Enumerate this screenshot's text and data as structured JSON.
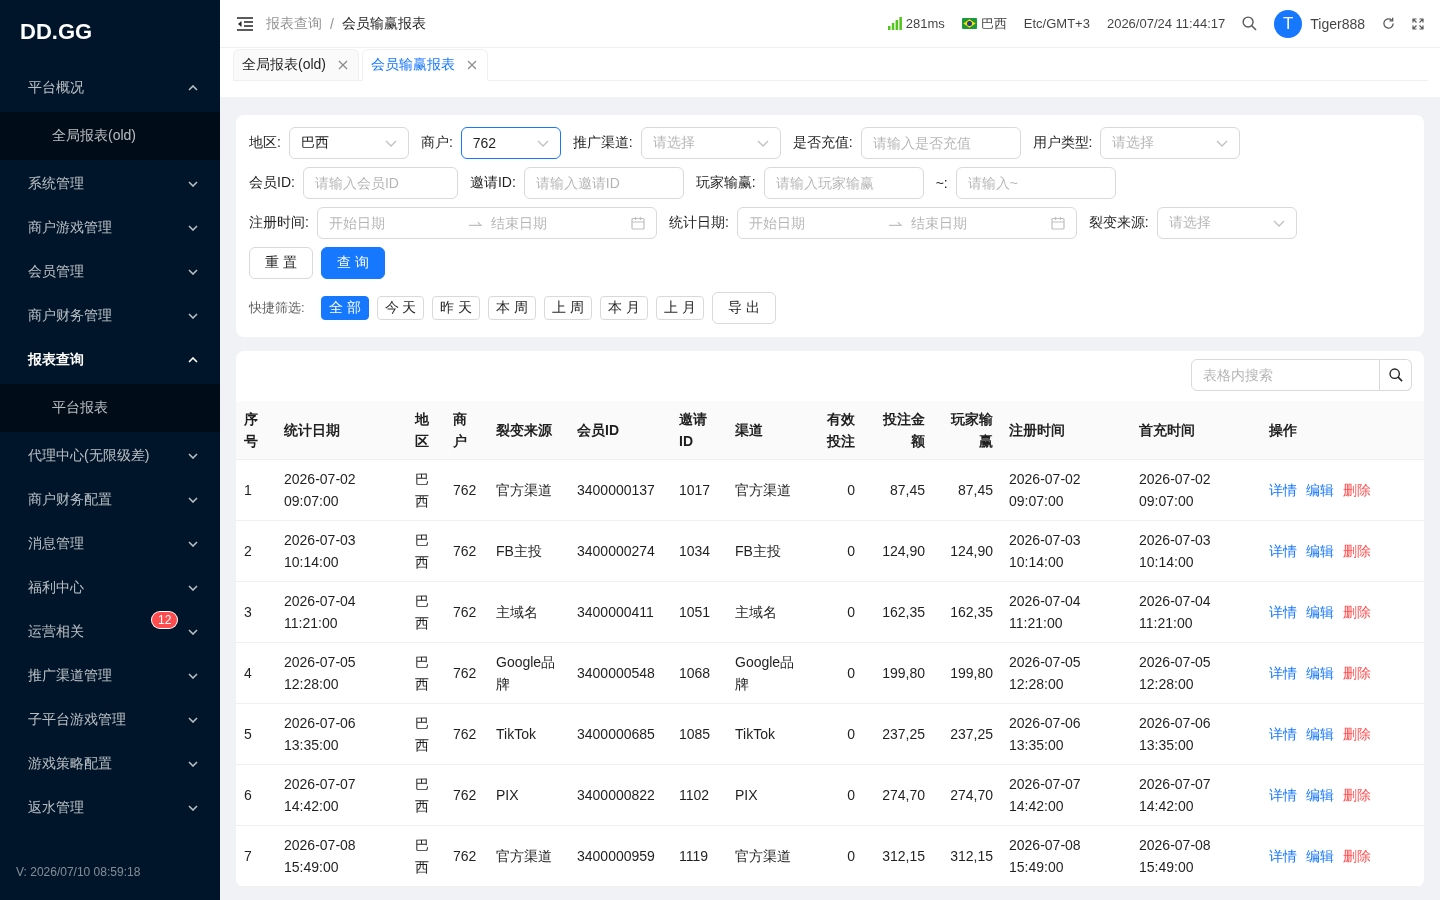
{
  "sidebar": {
    "logo": "DD.GG",
    "items": [
      {
        "label": "平台概况",
        "expanded": true,
        "selected": false,
        "children": [
          {
            "label": "全局报表(old)",
            "selected": false
          }
        ]
      },
      {
        "label": "系统管理",
        "expanded": false,
        "selected": false
      },
      {
        "label": "商户游戏管理",
        "expanded": false,
        "selected": false
      },
      {
        "label": "会员管理",
        "expanded": false,
        "selected": false
      },
      {
        "label": "商户财务管理",
        "expanded": false,
        "selected": false
      },
      {
        "label": "报表查询",
        "expanded": true,
        "selected": true,
        "children": [
          {
            "label": "平台报表",
            "selected": false
          }
        ]
      },
      {
        "label": "代理中心(无限级差)",
        "expanded": false,
        "selected": false
      },
      {
        "label": "商户财务配置",
        "expanded": false,
        "selected": false
      },
      {
        "label": "消息管理",
        "expanded": false,
        "selected": false
      },
      {
        "label": "福利中心",
        "expanded": false,
        "selected": false
      },
      {
        "label": "运营相关",
        "expanded": false,
        "selected": false,
        "badge": "12"
      },
      {
        "label": "推广渠道管理",
        "expanded": false,
        "selected": false
      },
      {
        "label": "子平台游戏管理",
        "expanded": false,
        "selected": false
      },
      {
        "label": "游戏策略配置",
        "expanded": false,
        "selected": false
      },
      {
        "label": "返水管理",
        "expanded": false,
        "selected": false
      }
    ],
    "version": "V: 2026/07/10 08:59:18"
  },
  "header": {
    "breadcrumb": [
      "报表查询",
      "会员输赢报表"
    ],
    "breadcrumb_separator": "/",
    "latency": "281ms",
    "region": "巴西",
    "timezone": "Etc/GMT+3",
    "datetime": "2026/07/24 11:44:17",
    "user": {
      "initial": "T",
      "name": "Tiger888"
    }
  },
  "tabs": [
    {
      "label": "全局报表(old)",
      "selected": false
    },
    {
      "label": "会员输赢报表",
      "selected": true
    }
  ],
  "filters": {
    "rows": [
      [
        {
          "kind": "select",
          "label": "地区:",
          "value": "巴西",
          "focused": false
        },
        {
          "kind": "select",
          "label": "商户:",
          "value": "762",
          "focused": true
        },
        {
          "kind": "select",
          "label": "推广渠道:",
          "placeholder": "请选择",
          "focused": false
        },
        {
          "kind": "input",
          "label": "是否充值:",
          "placeholder": "请输入是否充值",
          "focused": false
        },
        {
          "kind": "select",
          "label": "用户类型:",
          "placeholder": "请选择",
          "focused": false
        }
      ],
      [
        {
          "kind": "input",
          "label": "会员ID:",
          "placeholder": "请输入会员ID",
          "focused": false
        },
        {
          "kind": "input",
          "label": "邀请ID:",
          "placeholder": "请输入邀请ID",
          "focused": false
        },
        {
          "kind": "input",
          "label": "玩家输赢:",
          "placeholder": "请输入玩家输赢",
          "focused": false
        },
        {
          "kind": "input",
          "label": "~:",
          "placeholder": "请输入~",
          "focused": false
        }
      ],
      [
        {
          "kind": "daterange",
          "label": "注册时间:",
          "start_placeholder": "开始日期",
          "end_placeholder": "结束日期",
          "focused": false
        },
        {
          "kind": "daterange",
          "label": "统计日期:",
          "start_placeholder": "开始日期",
          "end_placeholder": "结束日期",
          "focused": false
        },
        {
          "kind": "select",
          "label": "裂变来源:",
          "placeholder": "请选择",
          "focused": false
        }
      ]
    ],
    "buttons": [
      {
        "label": "重 置",
        "kind": "default"
      },
      {
        "label": "查 询",
        "kind": "primary"
      }
    ],
    "quick_label": "快捷筛选:",
    "quick": [
      {
        "label": "全 部",
        "selected": true
      },
      {
        "label": "今 天",
        "selected": false
      },
      {
        "label": "昨 天",
        "selected": false
      },
      {
        "label": "本 周",
        "selected": false
      },
      {
        "label": "上 周",
        "selected": false
      },
      {
        "label": "本 月",
        "selected": false
      },
      {
        "label": "上 月",
        "selected": false
      }
    ],
    "export": "导 出"
  },
  "table": {
    "search_placeholder": "表格内搜索",
    "columns": [
      "序号",
      "统计日期",
      "地区",
      "商户",
      "裂变来源",
      "会员ID",
      "邀请ID",
      "渠道",
      "有效投注",
      "投注金额",
      "玩家输赢",
      "注册时间",
      "首充时间",
      "操作"
    ],
    "rows": [
      {
        "cells": [
          "1",
          "2026-07-02 09:07:00",
          "巴西",
          "762",
          "官方渠道",
          "3400000137",
          "1017",
          "官方渠道",
          "0",
          "87,45",
          "87,45",
          "2026-07-02 09:07:00",
          "2026-07-02 09:07:00"
        ],
        "actions": [
          {
            "label": "详情",
            "kind": "link"
          },
          {
            "label": "编辑",
            "kind": "link"
          },
          {
            "label": "删除",
            "kind": "danger"
          }
        ]
      },
      {
        "cells": [
          "2",
          "2026-07-03 10:14:00",
          "巴西",
          "762",
          "FB主投",
          "3400000274",
          "1034",
          "FB主投",
          "0",
          "124,90",
          "124,90",
          "2026-07-03 10:14:00",
          "2026-07-03 10:14:00"
        ],
        "actions": [
          {
            "label": "详情",
            "kind": "link"
          },
          {
            "label": "编辑",
            "kind": "link"
          },
          {
            "label": "删除",
            "kind": "danger"
          }
        ]
      },
      {
        "cells": [
          "3",
          "2026-07-04 11:21:00",
          "巴西",
          "762",
          "主域名",
          "3400000411",
          "1051",
          "主域名",
          "0",
          "162,35",
          "162,35",
          "2026-07-04 11:21:00",
          "2026-07-04 11:21:00"
        ],
        "actions": [
          {
            "label": "详情",
            "kind": "link"
          },
          {
            "label": "编辑",
            "kind": "link"
          },
          {
            "label": "删除",
            "kind": "danger"
          }
        ]
      },
      {
        "cells": [
          "4",
          "2026-07-05 12:28:00",
          "巴西",
          "762",
          "Google品牌",
          "3400000548",
          "1068",
          "Google品牌",
          "0",
          "199,80",
          "199,80",
          "2026-07-05 12:28:00",
          "2026-07-05 12:28:00"
        ],
        "actions": [
          {
            "label": "详情",
            "kind": "link"
          },
          {
            "label": "编辑",
            "kind": "link"
          },
          {
            "label": "删除",
            "kind": "danger"
          }
        ]
      },
      {
        "cells": [
          "5",
          "2026-07-06 13:35:00",
          "巴西",
          "762",
          "TikTok",
          "3400000685",
          "1085",
          "TikTok",
          "0",
          "237,25",
          "237,25",
          "2026-07-06 13:35:00",
          "2026-07-06 13:35:00"
        ],
        "actions": [
          {
            "label": "详情",
            "kind": "link"
          },
          {
            "label": "编辑",
            "kind": "link"
          },
          {
            "label": "删除",
            "kind": "danger"
          }
        ]
      },
      {
        "cells": [
          "6",
          "2026-07-07 14:42:00",
          "巴西",
          "762",
          "PIX",
          "3400000822",
          "1102",
          "PIX",
          "0",
          "274,70",
          "274,70",
          "2026-07-07 14:42:00",
          "2026-07-07 14:42:00"
        ],
        "actions": [
          {
            "label": "详情",
            "kind": "link"
          },
          {
            "label": "编辑",
            "kind": "link"
          },
          {
            "label": "删除",
            "kind": "danger"
          }
        ]
      },
      {
        "cells": [
          "7",
          "2026-07-08 15:49:00",
          "巴西",
          "762",
          "官方渠道",
          "3400000959",
          "1119",
          "官方渠道",
          "0",
          "312,15",
          "312,15",
          "2026-07-08 15:49:00",
          "2026-07-08 15:49:00"
        ],
        "actions": [
          {
            "label": "详情",
            "kind": "link"
          },
          {
            "label": "编辑",
            "kind": "link"
          },
          {
            "label": "删除",
            "kind": "danger"
          }
        ]
      }
    ]
  }
}
